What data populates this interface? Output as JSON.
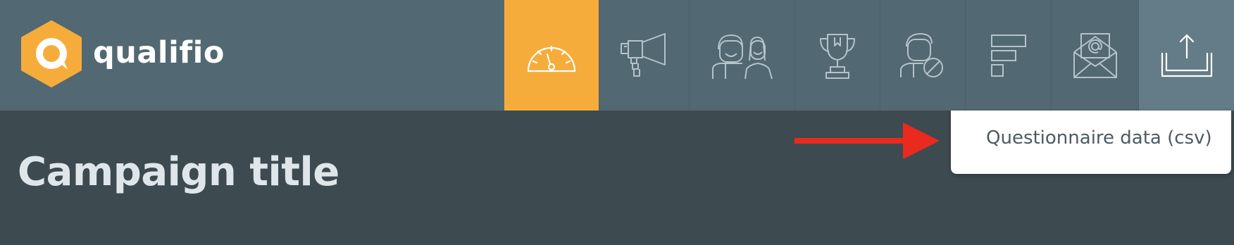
{
  "brand": {
    "name": "qualifio",
    "logo_color": "#f6ac3b"
  },
  "nav": {
    "items": [
      {
        "icon": "dashboard-gauge-icon",
        "active": true
      },
      {
        "icon": "megaphone-icon"
      },
      {
        "icon": "participants-icon"
      },
      {
        "icon": "trophy-icon"
      },
      {
        "icon": "blocked-user-icon"
      },
      {
        "icon": "bar-chart-icon"
      },
      {
        "icon": "email-icon"
      },
      {
        "icon": "export-upload-icon",
        "selected": true
      }
    ]
  },
  "page": {
    "title": "Campaign title"
  },
  "export_menu": {
    "items": [
      {
        "label": "Questionnaire data (csv)"
      }
    ]
  },
  "annotation": {
    "arrow_color": "#ea2a1e"
  }
}
